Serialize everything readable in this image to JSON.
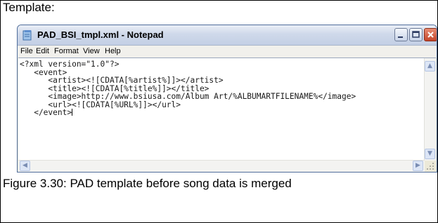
{
  "heading": "Template:",
  "window": {
    "title": "PAD_BSI_tmpl.xml - Notepad",
    "menu": [
      "File",
      "Edit",
      "Format",
      "View",
      "Help"
    ]
  },
  "editor": {
    "lines": [
      "<?xml version=\"1.0\"?>",
      "   <event>",
      "      <artist><![CDATA[%artist%]]></artist>",
      "      <title><![CDATA[%title%]]></title>",
      "      <image>http://www.bsiusa.com/Album Art/%ALBUMARTFILENAME%</image>",
      "      <url><![CDATA[%URL%]]></url>",
      "   </event>"
    ]
  },
  "caption": "Figure 3.30: PAD template before song data is merged",
  "colors": {
    "titlebar": "#cfd9ea",
    "close_button": "#c4452a",
    "border": "#4f6d9b"
  }
}
